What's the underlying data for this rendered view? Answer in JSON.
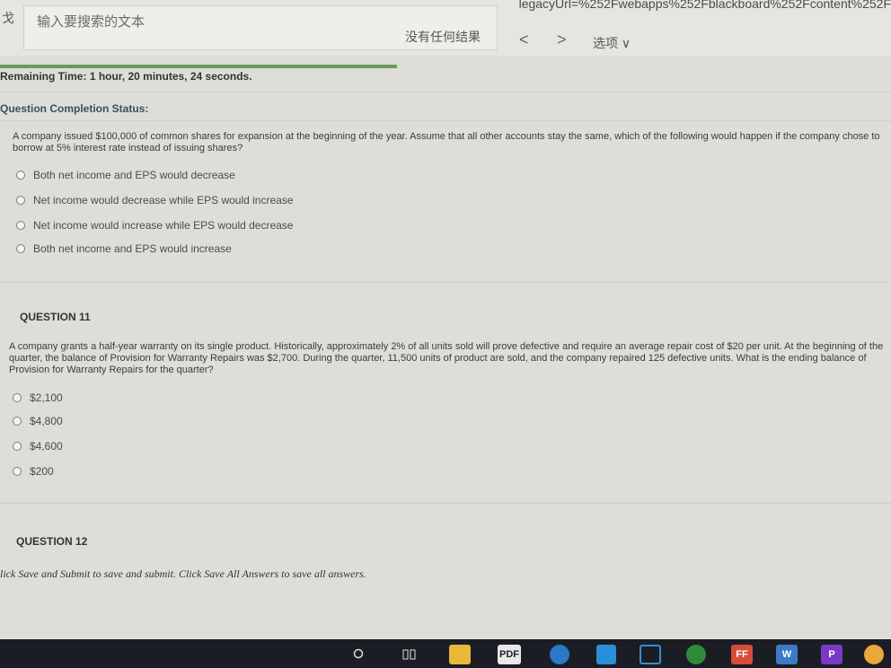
{
  "find_bar": {
    "url_fragment": "legacyUrl=%252Fwebapps%252Fblackboard%252Fcontent%252F",
    "left_char": "戈",
    "placeholder": "输入要搜索的文本",
    "no_results": "没有任何结果",
    "prev": "<",
    "next": ">",
    "options": "选项 ∨"
  },
  "remaining_time": {
    "label": "Remaining Time:",
    "value": "1 hour, 20 minutes, 24 seconds."
  },
  "completion_status": "Question Completion Status:",
  "question_10": {
    "text": "A company issued $100,000 of common shares for expansion at the beginning of the year. Assume that all other accounts stay the same, which of the following would happen if the company chose to borrow at 5% interest rate instead of issuing shares?",
    "options": [
      "Both net income and EPS would decrease",
      "Net income would decrease while EPS would increase",
      "Net income would increase while EPS would decrease",
      "Both net income and EPS would increase"
    ]
  },
  "question_11": {
    "title": "QUESTION 11",
    "text": "A company grants a half-year warranty on its single product. Historically, approximately 2% of all units sold will prove defective and require an average repair cost of $20 per unit. At the beginning of the quarter, the balance of Provision for Warranty Repairs was $2,700. During the quarter, 11,500 units of product are sold, and the company repaired 125 defective units. What is the ending balance of Provision for Warranty Repairs for the quarter?",
    "options": [
      "$2,100",
      "$4,800",
      "$4,600",
      "$200"
    ]
  },
  "question_12": {
    "title": "QUESTION 12"
  },
  "footer_note": "lick Save and Submit to save and submit. Click Save All Answers to save all answers.",
  "taskbar": {
    "pdf_label": "PDF",
    "ff_label": "FF",
    "w_label": "W",
    "p_label": "P"
  },
  "colors": {
    "progress": "#6a9a5c",
    "status_text": "#3a4e63"
  },
  "progress": {
    "percent": 100
  }
}
